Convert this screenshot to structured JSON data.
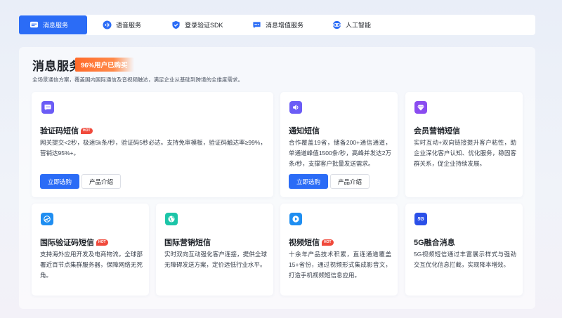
{
  "tabs": [
    {
      "label": "消息服务",
      "icon": "message-icon",
      "active": true
    },
    {
      "label": "语音服务",
      "icon": "voice-wave-icon",
      "active": false
    },
    {
      "label": "登录验证SDK",
      "icon": "shield-check-icon",
      "active": false
    },
    {
      "label": "消息增值服务",
      "icon": "chat-dots-icon",
      "active": false
    },
    {
      "label": "人工智能",
      "icon": "ai-orbit-icon",
      "active": false
    }
  ],
  "section": {
    "title": "消息服务",
    "badge": "96%用户已购买",
    "subtitle": "全场景通信方案，覆盖国内国际通信及音视频触达，满足企业从基础到跨境的全维度需求。"
  },
  "hot_label": "HOT",
  "cards": [
    {
      "title": "验证码短信",
      "hot": true,
      "icon": "chat-bubble-icon",
      "icon_color": "#6b5cf6",
      "desc": "网关提交<2秒，极速5k条/秒，验证码5秒必达。支持免审模板，验证码触达率≥99%，营销达95%+。",
      "primary": "立即选购",
      "secondary": "产品介绍"
    },
    {
      "title": "通知短信",
      "hot": false,
      "icon": "speaker-icon",
      "icon_color": "#6b5cf6",
      "desc": "合作覆盖19省，储备200+通信通道，单通道峰值1500条/秒，高峰并发达2万条/秒，支撑客户批量发送需求。",
      "primary": "立即选购",
      "secondary": "产品介绍"
    },
    {
      "title": "会员营销短信",
      "hot": false,
      "icon": "diamond-icon",
      "icon_color": "#8a4cf0",
      "desc": "实时互动+双向链接提升客户粘性，助企业深化客户认知、优化服务，稳固客群关系，促企业持续发展。"
    },
    {
      "title": "国际验证码短信",
      "hot": true,
      "icon": "global-message-icon",
      "icon_color": "#1f8ef1",
      "desc": "支持海外应用开发及电商物流，全球部署近百节点集群服务器，保障网络无死角。"
    },
    {
      "title": "国际营销短信",
      "hot": false,
      "icon": "globe-icon",
      "icon_color": "#1cc5a8",
      "desc": "实时双向互动强化客户连接，提供全球无障碍发送方案，定价远低行业水平。"
    },
    {
      "title": "视频短信",
      "hot": true,
      "icon": "play-icon",
      "icon_color": "#1f8ef1",
      "desc": "十余年产品技术积累，直连通道覆盖15+省份，通过视频形式集成影音文，打造手机视频短信息应用。"
    },
    {
      "title": "5G融合消息",
      "hot": false,
      "icon": "5g-icon",
      "icon_label": "5G",
      "icon_color": "#2b50e8",
      "desc": "5G视频短信通过丰富展示样式与强劲交互优化信息拦截，实现降本增效。"
    }
  ]
}
